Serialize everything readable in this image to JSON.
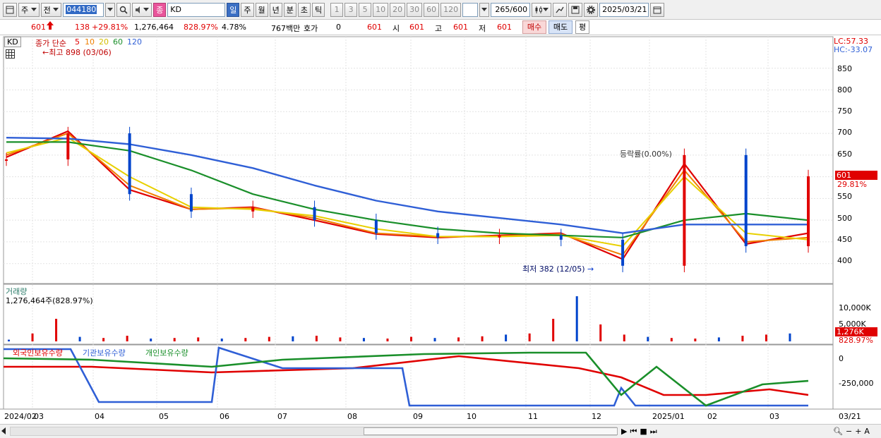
{
  "toolbar": {
    "period_main": "주",
    "prev": "전",
    "code": "044180",
    "tag": "종",
    "name": "KD",
    "periods": [
      "일",
      "주",
      "월",
      "년",
      "분",
      "초",
      "틱"
    ],
    "selected_period": "일",
    "intervals": [
      "1",
      "3",
      "5",
      "10",
      "20",
      "30",
      "60",
      "120"
    ],
    "count": "265",
    "count_total": "/600",
    "date": "2025/03/21"
  },
  "quote": {
    "price": "601",
    "change": "138",
    "change_pct": "+29.81%",
    "volume": "1,276,464",
    "volume_ratio": "828.97%",
    "turnover": "4.78%",
    "amount": "767백만",
    "quote_label": "호가",
    "quote_value": "0",
    "quote_price": "601",
    "open_label": "시",
    "open": "601",
    "high_label": "고",
    "high": "601",
    "low_label": "저",
    "low": "601",
    "buy": "매수",
    "sell": "매도",
    "avg": "평"
  },
  "price_pane": {
    "code_badge": "KD",
    "legend_title": "종가 단순",
    "ma_periods": [
      "5",
      "10",
      "20",
      "60",
      "120"
    ],
    "ma_colors": [
      "#e00000",
      "#f08000",
      "#e8d000",
      "#1a8f2a",
      "#2f5fd6"
    ],
    "max_label": "최고 898 (03/06)",
    "min_label": "최저 382 (12/05)",
    "rate_label": "등락률(0.00%)",
    "lc": "LC:57.33",
    "hc": "HC:-33.07",
    "price_tag": "601",
    "pct_tag": "29.81%",
    "y_ticks": [
      "850",
      "800",
      "750",
      "700",
      "650",
      "600",
      "550",
      "500",
      "450",
      "400"
    ]
  },
  "volume_pane": {
    "title": "거래량",
    "value": "1,276,464주(828.97%)",
    "y_ticks": [
      "10,000K",
      "5,000K"
    ],
    "tag": "1,276K",
    "tag_pct": "828.97%"
  },
  "holding_pane": {
    "legend": [
      "외국인보유수량",
      "기관보유수량",
      "개인보유수량"
    ],
    "legend_colors": [
      "#e00000",
      "#2f5fd6",
      "#1a8f2a"
    ],
    "y_ticks": [
      "0",
      "-250,000"
    ]
  },
  "x_axis": {
    "labels": [
      "2024/02",
      "03",
      "04",
      "05",
      "06",
      "07",
      "08",
      "09",
      "10",
      "11",
      "12",
      "2025/01",
      "02",
      "03"
    ],
    "right_label": "03/21"
  },
  "chart_data": {
    "type": "line",
    "title": "",
    "x": [
      "2024/02",
      "2024/03",
      "2024/04",
      "2024/05",
      "2024/06",
      "2024/07",
      "2024/08",
      "2024/09",
      "2024/10",
      "2024/11",
      "2024/12",
      "2025/01",
      "2025/02",
      "2025/03"
    ],
    "xlabel": "",
    "ylabel": "",
    "ylim": [
      380,
      900
    ],
    "series": [
      {
        "name": "종가",
        "values": [
          640,
          700,
          560,
          520,
          530,
          500,
          470,
          460,
          465,
          455,
          395,
          650,
          440,
          601
        ]
      },
      {
        "name": "5",
        "values": [
          645,
          705,
          570,
          525,
          530,
          500,
          468,
          460,
          465,
          470,
          410,
          630,
          445,
          470
        ]
      },
      {
        "name": "10",
        "values": [
          650,
          700,
          580,
          525,
          528,
          505,
          470,
          462,
          463,
          468,
          420,
          615,
          450,
          460
        ]
      },
      {
        "name": "20",
        "values": [
          655,
          690,
          600,
          530,
          525,
          510,
          480,
          462,
          462,
          465,
          440,
          600,
          470,
          455
        ]
      },
      {
        "name": "60",
        "values": [
          680,
          680,
          660,
          615,
          560,
          525,
          500,
          480,
          470,
          465,
          460,
          500,
          515,
          500
        ]
      },
      {
        "name": "120",
        "values": [
          690,
          688,
          675,
          650,
          620,
          580,
          545,
          520,
          505,
          490,
          470,
          490,
          490,
          490
        ]
      }
    ]
  }
}
